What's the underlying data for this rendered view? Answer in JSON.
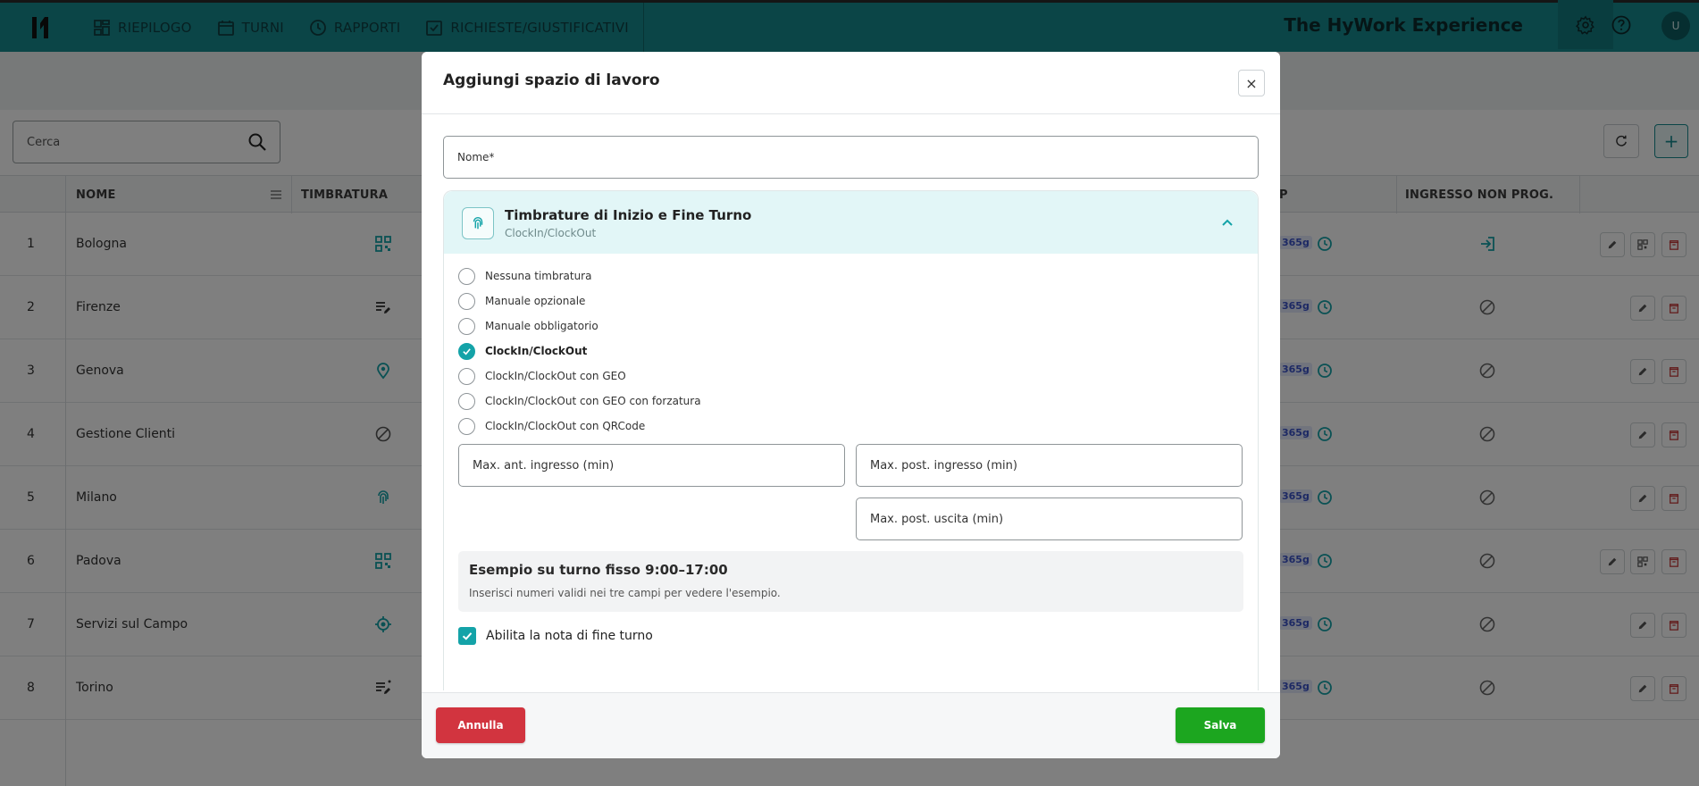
{
  "nav": {
    "items": [
      {
        "label": "RIEPILOGO",
        "icon": "dashboard-icon"
      },
      {
        "label": "TURNI",
        "icon": "calendar-icon"
      },
      {
        "label": "RAPPORTI",
        "icon": "clock-icon"
      },
      {
        "label": "RICHIESTE/GIUSTIFICATIVI",
        "icon": "checkbox-calendar-icon"
      }
    ],
    "brand": "The HyWork Experience",
    "avatar": "U",
    "colors": {
      "primary": "#168b8f",
      "dark": "#127a7e"
    }
  },
  "toolbar": {
    "search_placeholder": "Cerca"
  },
  "table": {
    "headers": {
      "nome": "NOME",
      "timbratura": "TIMBRATURA",
      "partial": "P",
      "ingresso": "INGRESSO NON PROG."
    },
    "badge": "365g",
    "rows": [
      {
        "idx": "1",
        "name": "Bologna",
        "icon": "qr-code-icon",
        "ingresso": "login-icon"
      },
      {
        "idx": "2",
        "name": "Firenze",
        "icon": "edit-list-icon",
        "ingresso": "blocked-icon"
      },
      {
        "idx": "3",
        "name": "Genova",
        "icon": "location-pin-icon",
        "ingresso": "blocked-icon"
      },
      {
        "idx": "4",
        "name": "Gestione Clienti",
        "icon": "blocked-icon",
        "ingresso": "blocked-icon"
      },
      {
        "idx": "5",
        "name": "Milano",
        "icon": "fingerprint-icon",
        "ingresso": "blocked-icon"
      },
      {
        "idx": "6",
        "name": "Padova",
        "icon": "qr-code-icon",
        "ingresso": "blocked-icon"
      },
      {
        "idx": "7",
        "name": "Servizi sul Campo",
        "icon": "gps-target-icon",
        "ingresso": "blocked-icon"
      },
      {
        "idx": "8",
        "name": "Torino",
        "icon": "edit-list-required-icon",
        "ingresso": "blocked-icon"
      }
    ]
  },
  "modal": {
    "title": "Aggiungi spazio di lavoro",
    "close": "×",
    "nome_placeholder": "Nome*",
    "accordion": {
      "title": "Timbrature di Inizio e Fine Turno",
      "subtitle": "ClockIn/ClockOut",
      "options": [
        {
          "label": "Nessuna timbratura",
          "selected": false
        },
        {
          "label": "Manuale opzionale",
          "selected": false
        },
        {
          "label": "Manuale obbligatorio",
          "selected": false
        },
        {
          "label": "ClockIn/ClockOut",
          "selected": true
        },
        {
          "label": "ClockIn/ClockOut con GEO",
          "selected": false
        },
        {
          "label": "ClockIn/ClockOut con GEO con forzatura",
          "selected": false
        },
        {
          "label": "ClockIn/ClockOut con QRCode",
          "selected": false
        }
      ],
      "fields": {
        "max_ant_ingresso": "Max. ant. ingresso (min)",
        "max_post_ingresso": "Max. post. ingresso (min)",
        "max_post_uscita": "Max. post. uscita (min)"
      },
      "example": {
        "title": "Esempio su turno fisso 9:00–17:00",
        "text": "Inserisci numeri validi nei tre campi per vedere l'esempio."
      },
      "checkbox_label": "Abilita la nota di fine turno",
      "checkbox_checked": true
    },
    "cancel": "Annulla",
    "save": "Salva",
    "colors": {
      "cancel": "#d2343f",
      "save": "#1ca61f",
      "accent": "#14a3a8"
    }
  }
}
